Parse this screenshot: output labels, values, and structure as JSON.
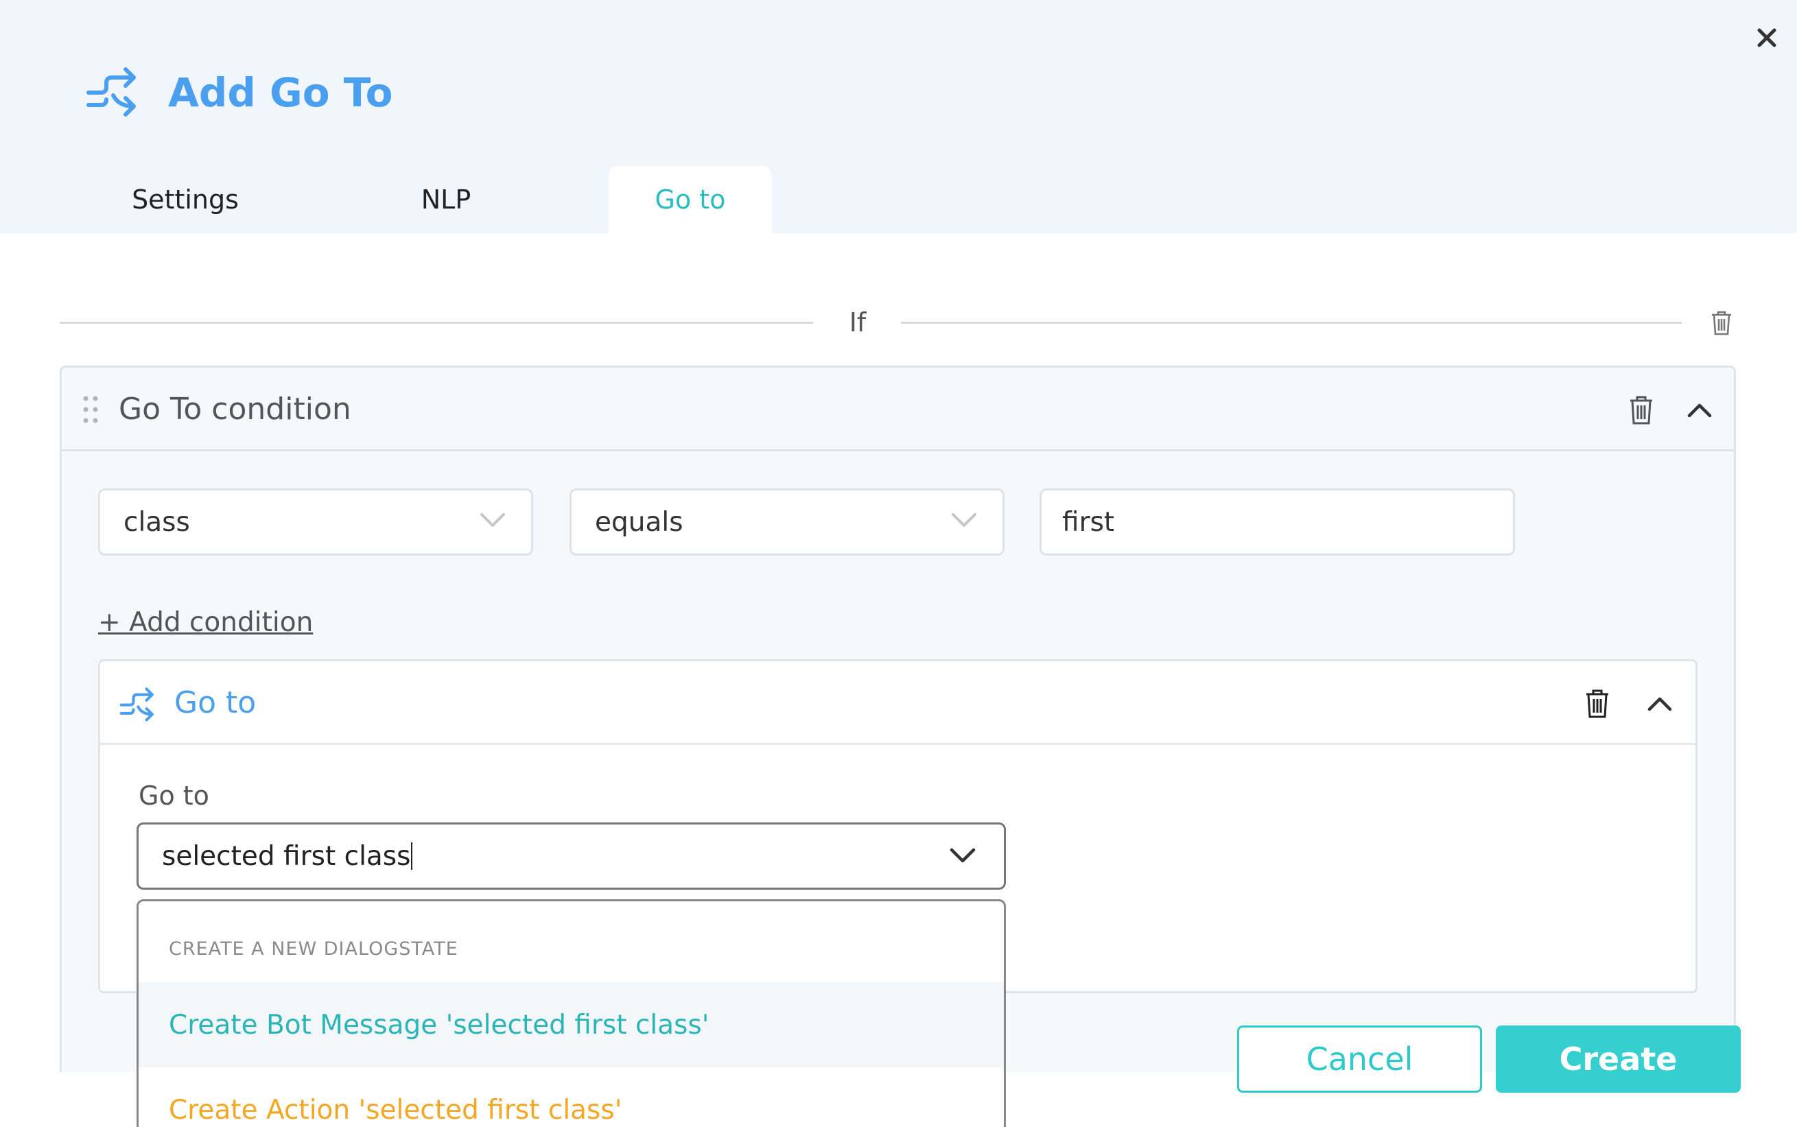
{
  "dialog": {
    "title": "Add Go To",
    "close_icon": "close-icon",
    "accent_color": "#2bbdbd",
    "title_color": "#4a9fee"
  },
  "tabs": [
    {
      "label": "Settings",
      "active": false
    },
    {
      "label": "NLP",
      "active": false
    },
    {
      "label": "Go to",
      "active": true
    }
  ],
  "if_section": {
    "label": "If"
  },
  "condition": {
    "title": "Go To condition",
    "field": "class",
    "operator": "equals",
    "value": "first",
    "add_condition_label": "+ Add condition"
  },
  "goto": {
    "title": "Go to",
    "field_label": "Go to",
    "input_value": "selected first class",
    "dropdown": {
      "section_label": "CREATE A NEW DIALOGSTATE",
      "options": [
        {
          "label": "Create Bot Message 'selected first class'",
          "color": "#2bb5b5"
        },
        {
          "label": "Create Action 'selected first class'",
          "color": "#f5a623"
        }
      ]
    }
  },
  "footer": {
    "cancel_label": "Cancel",
    "create_label": "Create"
  }
}
